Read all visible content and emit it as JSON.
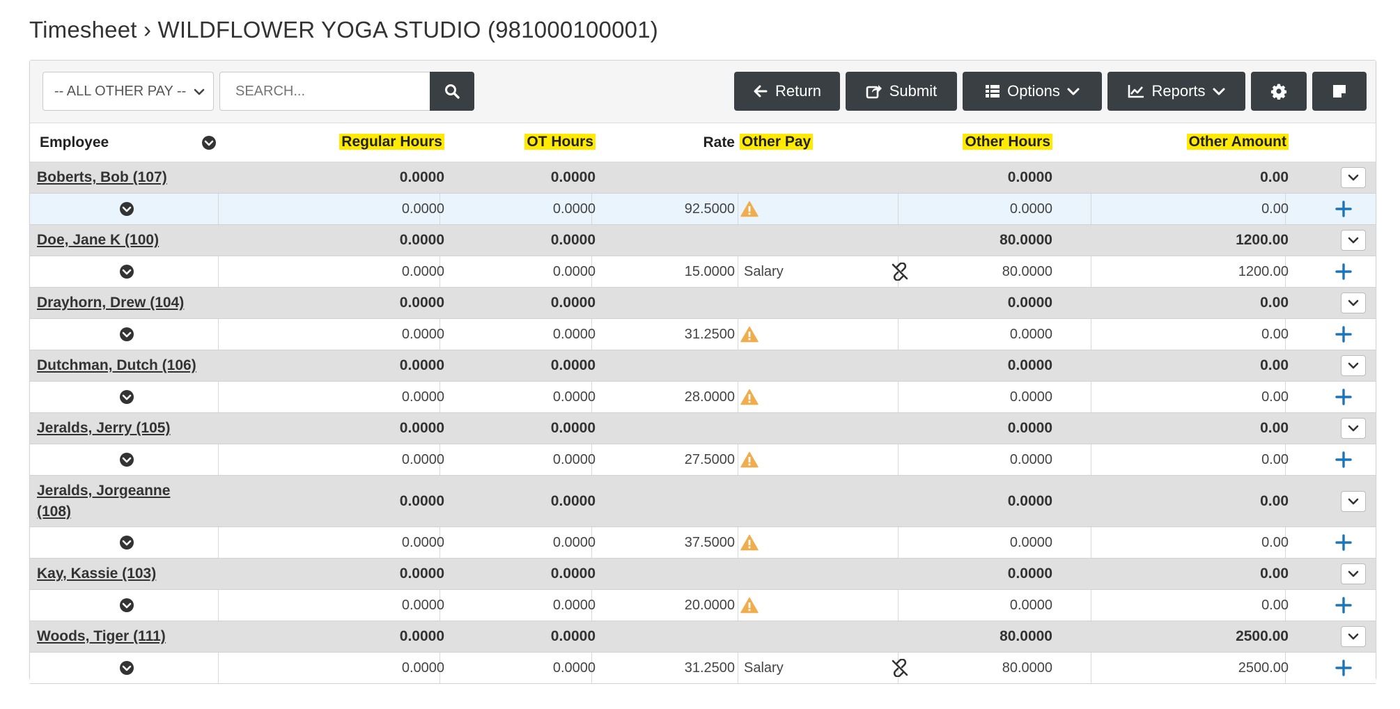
{
  "page": {
    "title": "Timesheet › WILDFLOWER YOGA STUDIO (981000100001)"
  },
  "toolbar": {
    "filter_value": "-- ALL OTHER PAY --",
    "search_placeholder": "SEARCH...",
    "return_label": "Return",
    "submit_label": "Submit",
    "options_label": "Options",
    "reports_label": "Reports"
  },
  "columns": {
    "employee": "Employee",
    "regular_hours": "Regular Hours",
    "ot_hours": "OT Hours",
    "rate": "Rate",
    "other_pay": "Other Pay",
    "other_hours": "Other Hours",
    "other_amount": "Other Amount"
  },
  "employees": [
    {
      "name": "Boberts, Bob (107)",
      "sum_reg": "0.0000",
      "sum_ot": "0.0000",
      "sum_other_hours": "0.0000",
      "sum_other_amount": "0.00",
      "reg": "0.0000",
      "ot": "0.0000",
      "rate": "92.5000",
      "other_pay": "",
      "other_hours": "0.0000",
      "other_amount": "0.00"
    },
    {
      "name": "Doe, Jane K (100)",
      "sum_reg": "0.0000",
      "sum_ot": "0.0000",
      "sum_other_hours": "80.0000",
      "sum_other_amount": "1200.00",
      "reg": "0.0000",
      "ot": "0.0000",
      "rate": "15.0000",
      "other_pay": "Salary",
      "other_hours": "80.0000",
      "other_amount": "1200.00"
    },
    {
      "name": "Drayhorn, Drew (104)",
      "sum_reg": "0.0000",
      "sum_ot": "0.0000",
      "sum_other_hours": "0.0000",
      "sum_other_amount": "0.00",
      "reg": "0.0000",
      "ot": "0.0000",
      "rate": "31.2500",
      "other_pay": "",
      "other_hours": "0.0000",
      "other_amount": "0.00"
    },
    {
      "name": "Dutchman, Dutch (106)",
      "sum_reg": "0.0000",
      "sum_ot": "0.0000",
      "sum_other_hours": "0.0000",
      "sum_other_amount": "0.00",
      "reg": "0.0000",
      "ot": "0.0000",
      "rate": "28.0000",
      "other_pay": "",
      "other_hours": "0.0000",
      "other_amount": "0.00"
    },
    {
      "name": "Jeralds, Jerry (105)",
      "sum_reg": "0.0000",
      "sum_ot": "0.0000",
      "sum_other_hours": "0.0000",
      "sum_other_amount": "0.00",
      "reg": "0.0000",
      "ot": "0.0000",
      "rate": "27.5000",
      "other_pay": "",
      "other_hours": "0.0000",
      "other_amount": "0.00"
    },
    {
      "name": "Jeralds, Jorgeanne (108)",
      "sum_reg": "0.0000",
      "sum_ot": "0.0000",
      "sum_other_hours": "0.0000",
      "sum_other_amount": "0.00",
      "reg": "0.0000",
      "ot": "0.0000",
      "rate": "37.5000",
      "other_pay": "",
      "other_hours": "0.0000",
      "other_amount": "0.00"
    },
    {
      "name": "Kay, Kassie (103)",
      "sum_reg": "0.0000",
      "sum_ot": "0.0000",
      "sum_other_hours": "0.0000",
      "sum_other_amount": "0.00",
      "reg": "0.0000",
      "ot": "0.0000",
      "rate": "20.0000",
      "other_pay": "",
      "other_hours": "0.0000",
      "other_amount": "0.00"
    },
    {
      "name": "Woods, Tiger (111)",
      "sum_reg": "0.0000",
      "sum_ot": "0.0000",
      "sum_other_hours": "80.0000",
      "sum_other_amount": "2500.00",
      "reg": "0.0000",
      "ot": "0.0000",
      "rate": "31.2500",
      "other_pay": "Salary",
      "other_hours": "80.0000",
      "other_amount": "2500.00"
    }
  ],
  "row_icons": [
    "warning-icon",
    "unlink-icon",
    "warning-icon",
    "warning-icon",
    "warning-icon",
    "warning-icon",
    "warning-icon",
    "unlink-icon"
  ],
  "colors": {
    "button_bg": "#3a3f44",
    "highlight": "#ffea00",
    "summary_row_bg": "#e0e0e0",
    "warning": "#f0ad4e",
    "plus": "#1b75bc"
  }
}
